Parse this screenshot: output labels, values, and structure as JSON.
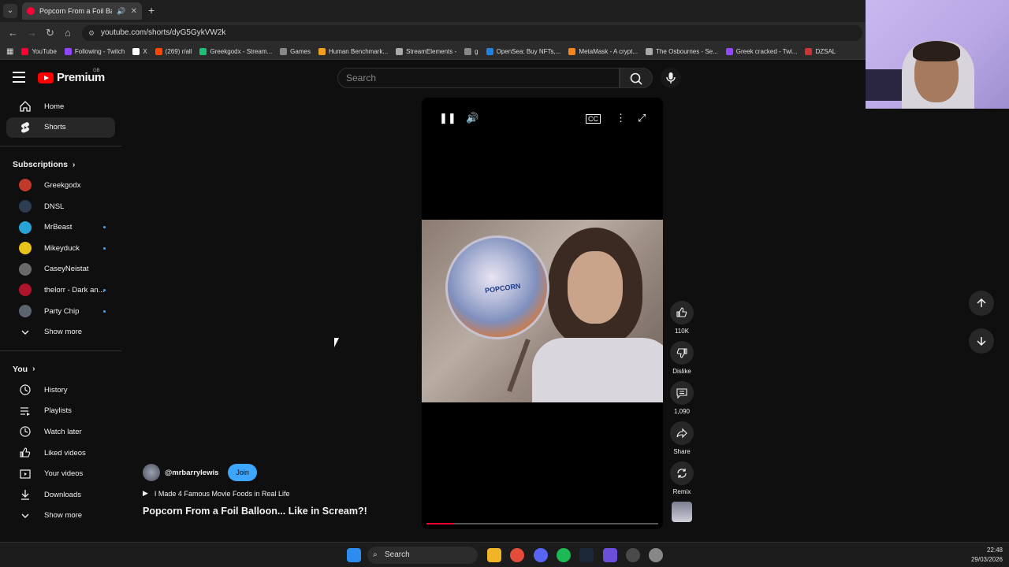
{
  "browser": {
    "tab_title": "Popcorn From a Foil Balloon...",
    "url": "youtube.com/shorts/dyG5GykVW2k",
    "bookmarks": [
      "YouTube",
      "Following - Twitch",
      "X",
      "(269) r/all",
      "Greekgodx - Stream...",
      "Games",
      "Human Benchmark...",
      "StreamElements -",
      "g",
      "OpenSea: Buy NFTs,...",
      "MetaMask - A crypt...",
      "The Osbournes - Se...",
      "Greek cracked - Twi...",
      "DZSAL"
    ]
  },
  "header": {
    "logo_text": "Premium",
    "logo_country": "GB",
    "search_placeholder": "Search"
  },
  "sidebar": {
    "main": [
      {
        "label": "Home",
        "icon": "home-icon"
      },
      {
        "label": "Shorts",
        "icon": "shorts-icon",
        "active": true
      }
    ],
    "subscriptions_title": "Subscriptions",
    "subscriptions": [
      {
        "label": "Greekgodx",
        "color": "#c0392b",
        "new": false
      },
      {
        "label": "DNSL",
        "color": "#2c3e50",
        "new": false
      },
      {
        "label": "MrBeast",
        "color": "#27a3d6",
        "new": true
      },
      {
        "label": "Mikeyduck",
        "color": "#e8c31a",
        "new": true
      },
      {
        "label": "CaseyNeistat",
        "color": "#6a6a6a",
        "new": false
      },
      {
        "label": "thelorr - Dark an...",
        "color": "#b0142c",
        "new": true
      },
      {
        "label": "Party Chip",
        "color": "#5c6470",
        "new": true
      }
    ],
    "subs_show_more": "Show more",
    "you_title": "You",
    "you": [
      {
        "label": "History",
        "icon": "history-icon"
      },
      {
        "label": "Playlists",
        "icon": "playlists-icon"
      },
      {
        "label": "Watch later",
        "icon": "watch-later-icon"
      },
      {
        "label": "Liked videos",
        "icon": "like-icon"
      },
      {
        "label": "Your videos",
        "icon": "video-icon"
      },
      {
        "label": "Downloads",
        "icon": "download-icon"
      }
    ],
    "you_show_more": "Show more"
  },
  "player": {
    "balloon_text": "POPCORN",
    "progress": 0.12
  },
  "actions": {
    "like_count": "110K",
    "dislike_label": "Dislike",
    "comments_count": "1,090",
    "share_label": "Share",
    "remix_label": "Remix"
  },
  "channel": {
    "name": "@mrbarrylewis",
    "join_label": "Join",
    "playlist": "I Made 4 Famous Movie Foods in Real Life",
    "title": "Popcorn From a Foil Balloon... Like in Scream?!"
  },
  "taskbar": {
    "search_label": "Search",
    "time": "22:48",
    "date": "29/03/2026"
  }
}
